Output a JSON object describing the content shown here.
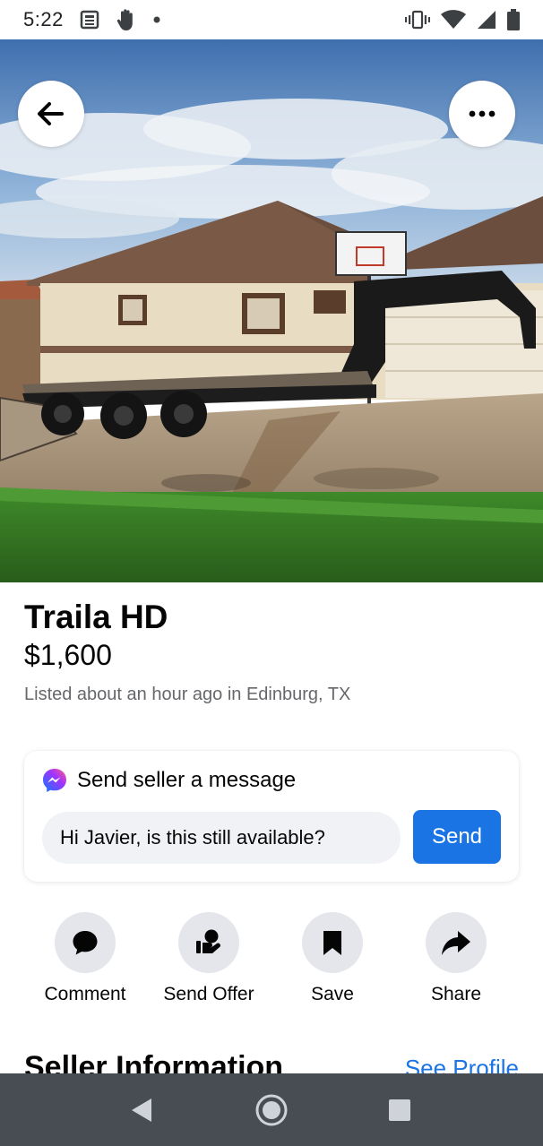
{
  "status_bar": {
    "time": "5:22",
    "icons_left": [
      "news-icon",
      "hand-icon",
      "dot-icon"
    ],
    "icons_right": [
      "vibrate-icon",
      "wifi-icon",
      "signal-icon",
      "battery-icon"
    ]
  },
  "photo": {
    "buttons": {
      "back": "back-arrow-icon",
      "more": "more-options-icon"
    }
  },
  "listing": {
    "title": "Traila HD",
    "price": "$1,600",
    "meta": "Listed about an hour ago in Edinburg, TX"
  },
  "message_card": {
    "heading": "Send seller a message",
    "input_value": "Hi Javier, is this still available?",
    "send_label": "Send",
    "icon": "messenger-icon"
  },
  "actions": [
    {
      "label": "Comment",
      "icon": "comment-icon"
    },
    {
      "label": "Send Offer",
      "icon": "offer-icon"
    },
    {
      "label": "Save",
      "icon": "bookmark-icon"
    },
    {
      "label": "Share",
      "icon": "share-icon"
    }
  ],
  "seller_section": {
    "heading": "Seller Information",
    "link": "See Profile"
  },
  "nav_bar": {
    "icons": [
      "nav-back-icon",
      "nav-home-icon",
      "nav-recents-icon"
    ]
  },
  "colors": {
    "accent": "#1b74e4",
    "secondary_text": "#65676b",
    "input_bg": "#f0f2f5",
    "action_circle": "#e4e6eb",
    "nav_bar": "#474d52"
  }
}
